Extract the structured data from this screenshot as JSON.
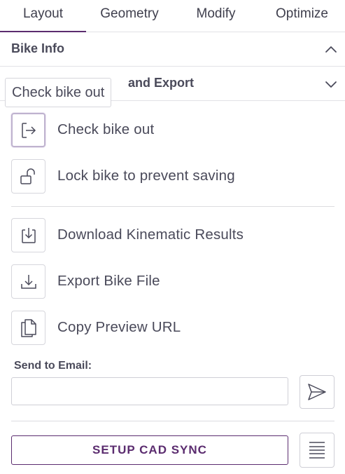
{
  "tabs": [
    {
      "label": "Layout",
      "active": true
    },
    {
      "label": "Geometry"
    },
    {
      "label": "Modify"
    },
    {
      "label": "Optimize"
    }
  ],
  "sections": {
    "bike_info": {
      "title": "Bike Info",
      "expanded": true
    },
    "export": {
      "title": "and Export",
      "expanded": false
    }
  },
  "tooltip": {
    "text": "Check bike out"
  },
  "actions": [
    {
      "label": "Check bike out",
      "icon": "logout-arrow-icon"
    },
    {
      "label": "Lock bike to prevent saving",
      "icon": "unlock-icon"
    },
    {
      "label": "Download Kinematic Results",
      "icon": "download-box-icon"
    },
    {
      "label": "Export Bike File",
      "icon": "download-icon"
    },
    {
      "label": "Copy Preview URL",
      "icon": "copy-icon"
    }
  ],
  "email": {
    "label": "Send to Email:",
    "value": "",
    "placeholder": ""
  },
  "cad": {
    "label": "SETUP CAD SYNC"
  },
  "colors": {
    "accent": "#5b2c6f",
    "text": "#4a4a5a",
    "border": "#d6d6dc"
  }
}
